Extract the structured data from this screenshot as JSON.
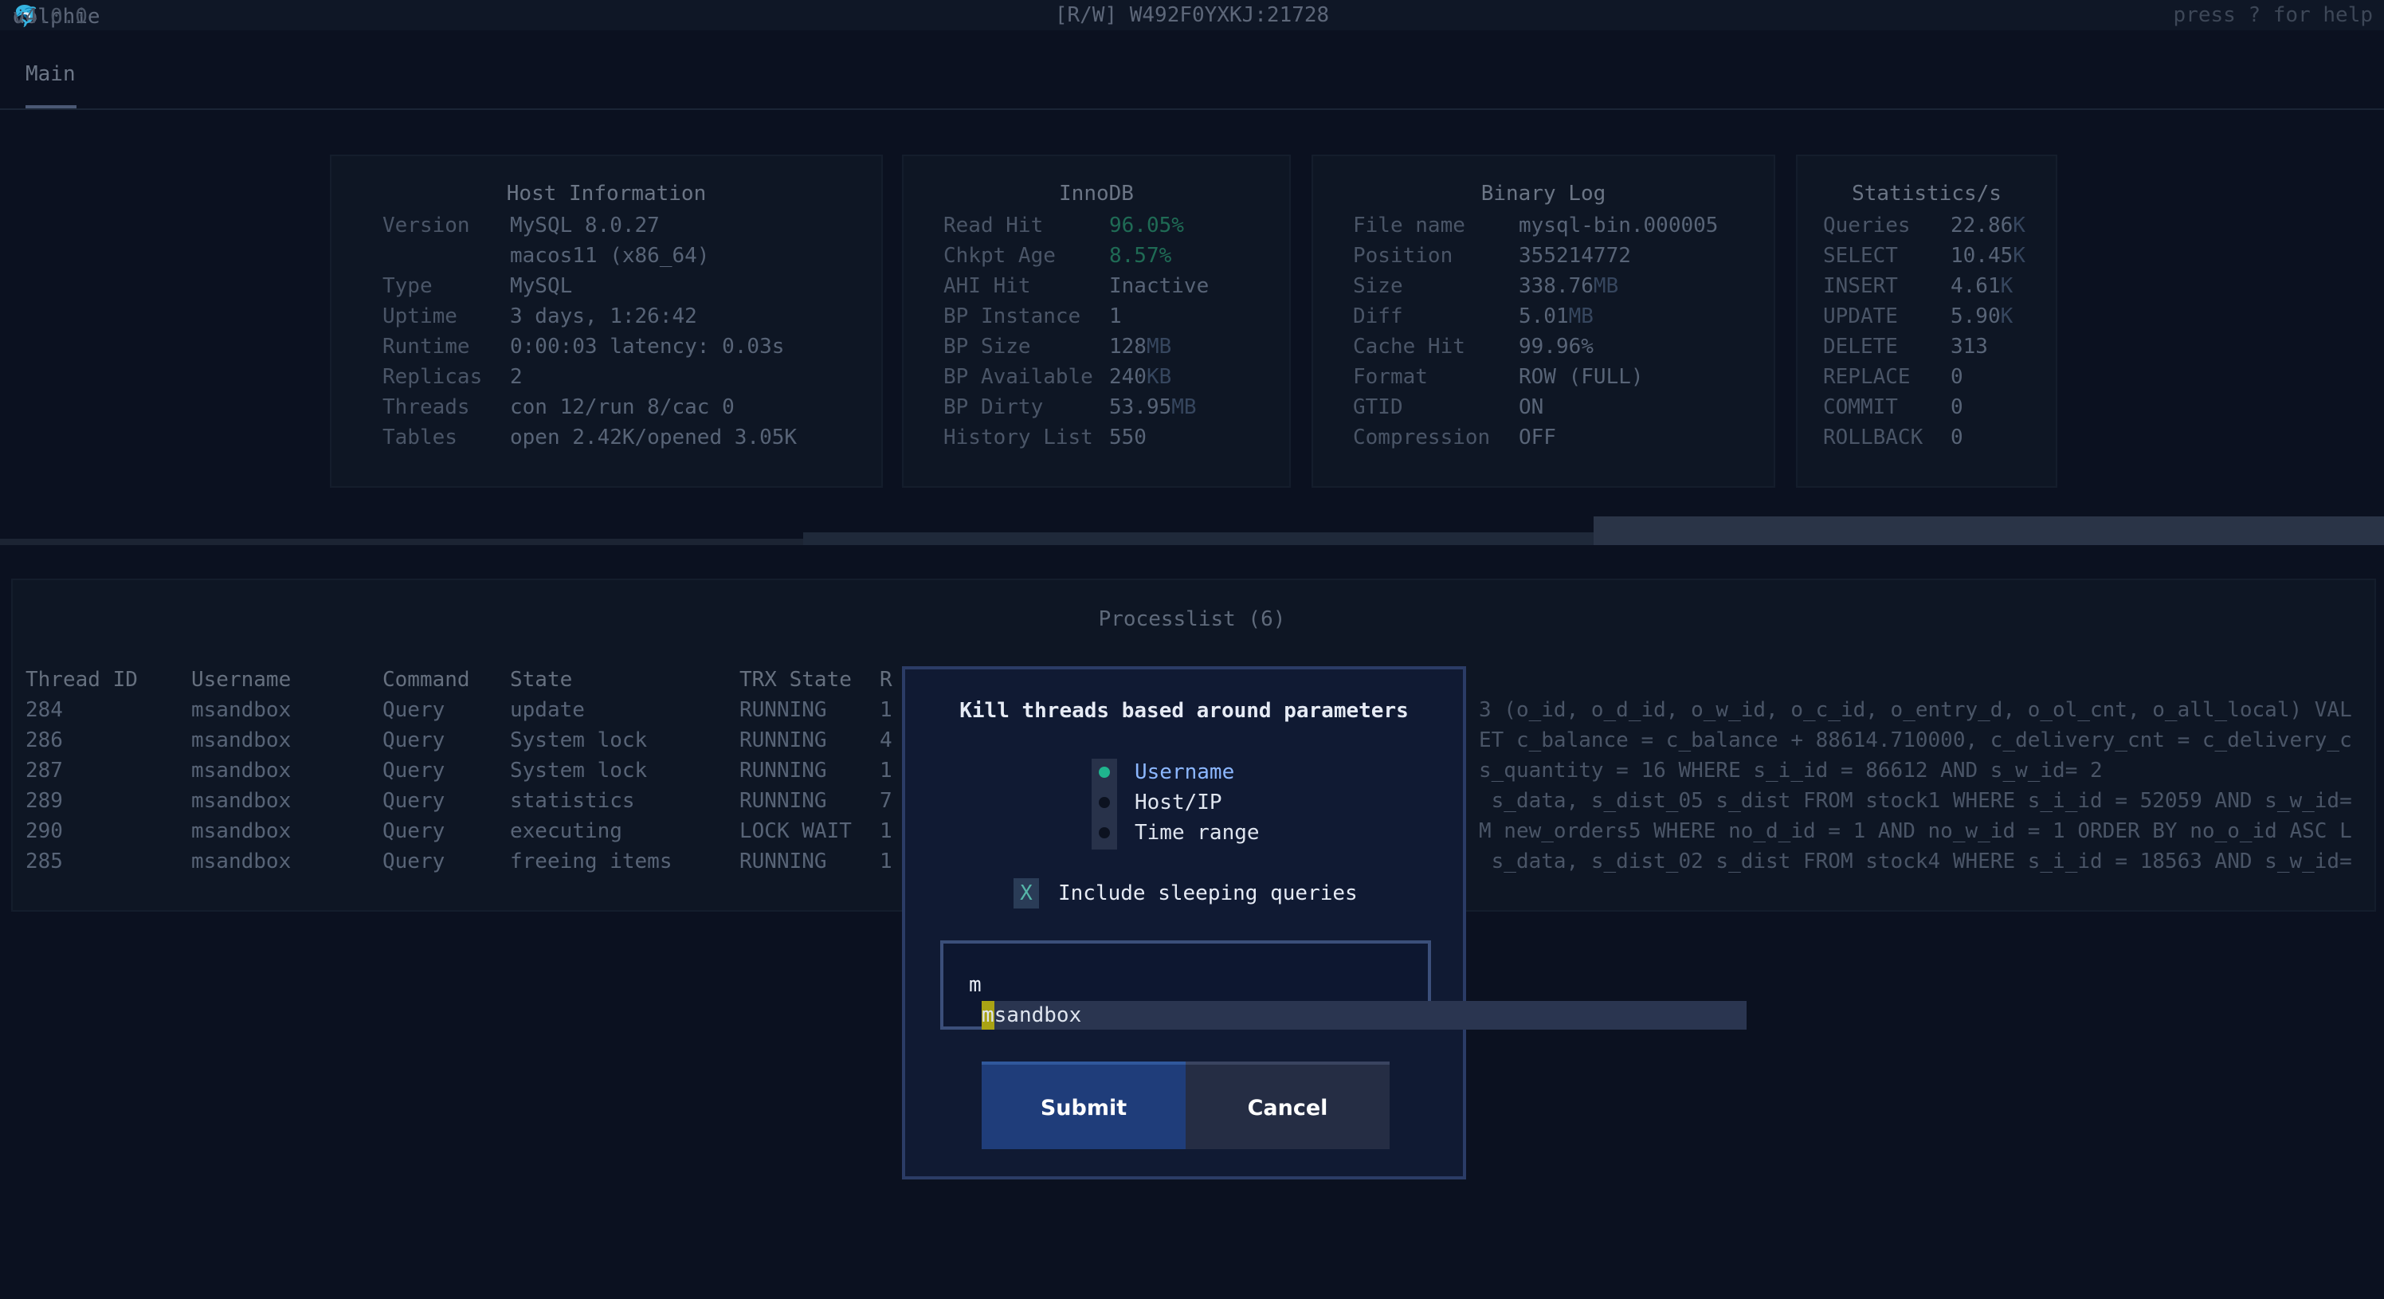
{
  "header": {
    "app_name": "dolphie",
    "app_icon": "dolphin-icon",
    "version": "v4.0.0",
    "connection": "[R/W] W492F0YXKJ:21728",
    "help": "press ? for help"
  },
  "tabs": [
    {
      "label": "Main"
    }
  ],
  "host_information": {
    "title": "Host Information",
    "rows": [
      {
        "label": "Version",
        "value": "MySQL 8.0.27"
      },
      {
        "label": "",
        "value": "macos11 (x86_64)"
      },
      {
        "label": "Type",
        "value": "MySQL"
      },
      {
        "label": "Uptime",
        "value": "3 days, 1:26:42"
      },
      {
        "label": "Runtime",
        "value": "0:00:03 latency: 0.03s"
      },
      {
        "label": "Replicas",
        "value": "2"
      },
      {
        "label": "Threads",
        "value": "con 12/run 8/cac 0"
      },
      {
        "label": "Tables",
        "value": "open 2.42K/opened 3.05K"
      }
    ]
  },
  "innodb": {
    "title": "InnoDB",
    "rows": [
      {
        "label": "Read Hit",
        "value": "96.05%"
      },
      {
        "label": "Chkpt Age",
        "value": "8.57%"
      },
      {
        "label": "AHI Hit",
        "value": "Inactive"
      },
      {
        "label": "BP Instance",
        "value": "1"
      },
      {
        "label": "BP Size",
        "value": "128",
        "unit": "MB"
      },
      {
        "label": "BP Available",
        "value": "240",
        "unit": "KB"
      },
      {
        "label": "BP Dirty",
        "value": "53.95",
        "unit": "MB"
      },
      {
        "label": "History List",
        "value": "550"
      }
    ]
  },
  "binary_log": {
    "title": "Binary Log",
    "rows": [
      {
        "label": "File name",
        "value": "mysql-bin.000005"
      },
      {
        "label": "Position",
        "value": "355214772"
      },
      {
        "label": "Size",
        "value": "338.76",
        "unit": "MB"
      },
      {
        "label": "Diff",
        "value": "5.01",
        "unit": "MB"
      },
      {
        "label": "Cache Hit",
        "value": "99.96%"
      },
      {
        "label": "Format",
        "value": "ROW (FULL)"
      },
      {
        "label": "GTID",
        "value": "ON"
      },
      {
        "label": "Compression",
        "value": "OFF"
      }
    ]
  },
  "statistics": {
    "title": "Statistics/s",
    "rows": [
      {
        "label": "Queries",
        "value": "22.86",
        "unit": "K"
      },
      {
        "label": "SELECT",
        "value": "10.45",
        "unit": "K"
      },
      {
        "label": "INSERT",
        "value": "4.61",
        "unit": "K"
      },
      {
        "label": "UPDATE",
        "value": "5.90",
        "unit": "K"
      },
      {
        "label": "DELETE",
        "value": "313"
      },
      {
        "label": "REPLACE",
        "value": "0"
      },
      {
        "label": "COMMIT",
        "value": "0"
      },
      {
        "label": "ROLLBACK",
        "value": "0"
      }
    ]
  },
  "processlist": {
    "title": "Processlist (6)",
    "columns": [
      "Thread ID",
      "Username",
      "Command",
      "State",
      "TRX State",
      "R"
    ],
    "rows": [
      {
        "thread_id": "284",
        "username": "msandbox",
        "command": "Query",
        "state": "update",
        "trx_state": "RUNNING",
        "r": "1",
        "query": "3 (o_id, o_d_id, o_w_id, o_c_id, o_entry_d, o_ol_cnt, o_all_local) VAL"
      },
      {
        "thread_id": "286",
        "username": "msandbox",
        "command": "Query",
        "state": "System lock",
        "trx_state": "RUNNING",
        "r": "4",
        "query": "ET c_balance = c_balance + 88614.710000, c_delivery_cnt = c_delivery_c"
      },
      {
        "thread_id": "287",
        "username": "msandbox",
        "command": "Query",
        "state": "System lock",
        "trx_state": "RUNNING",
        "r": "1",
        "query": "s_quantity = 16 WHERE s_i_id = 86612 AND s_w_id= 2"
      },
      {
        "thread_id": "289",
        "username": "msandbox",
        "command": "Query",
        "state": "statistics",
        "trx_state": "RUNNING",
        "r": "7",
        "query": " s_data, s_dist_05 s_dist FROM stock1 WHERE s_i_id = 52059 AND s_w_id="
      },
      {
        "thread_id": "290",
        "username": "msandbox",
        "command": "Query",
        "state": "executing",
        "trx_state": "LOCK WAIT",
        "r": "1",
        "query": "M new_orders5 WHERE no_d_id = 1 AND no_w_id = 1 ORDER BY no_o_id ASC L"
      },
      {
        "thread_id": "285",
        "username": "msandbox",
        "command": "Query",
        "state": "freeing items",
        "trx_state": "RUNNING",
        "r": "1",
        "query": " s_data, s_dist_02 s_dist FROM stock4 WHERE s_i_id = 18563 AND s_w_id="
      }
    ]
  },
  "modal": {
    "title": "Kill threads based around parameters",
    "options": [
      {
        "label": "Username",
        "selected": true
      },
      {
        "label": "Host/IP",
        "selected": false
      },
      {
        "label": "Time range",
        "selected": false
      }
    ],
    "checkbox_mark": "X",
    "checkbox_label": "Include sleeping queries",
    "input_value": "m",
    "suggestion": "msandbox",
    "submit_label": "Submit",
    "cancel_label": "Cancel"
  }
}
